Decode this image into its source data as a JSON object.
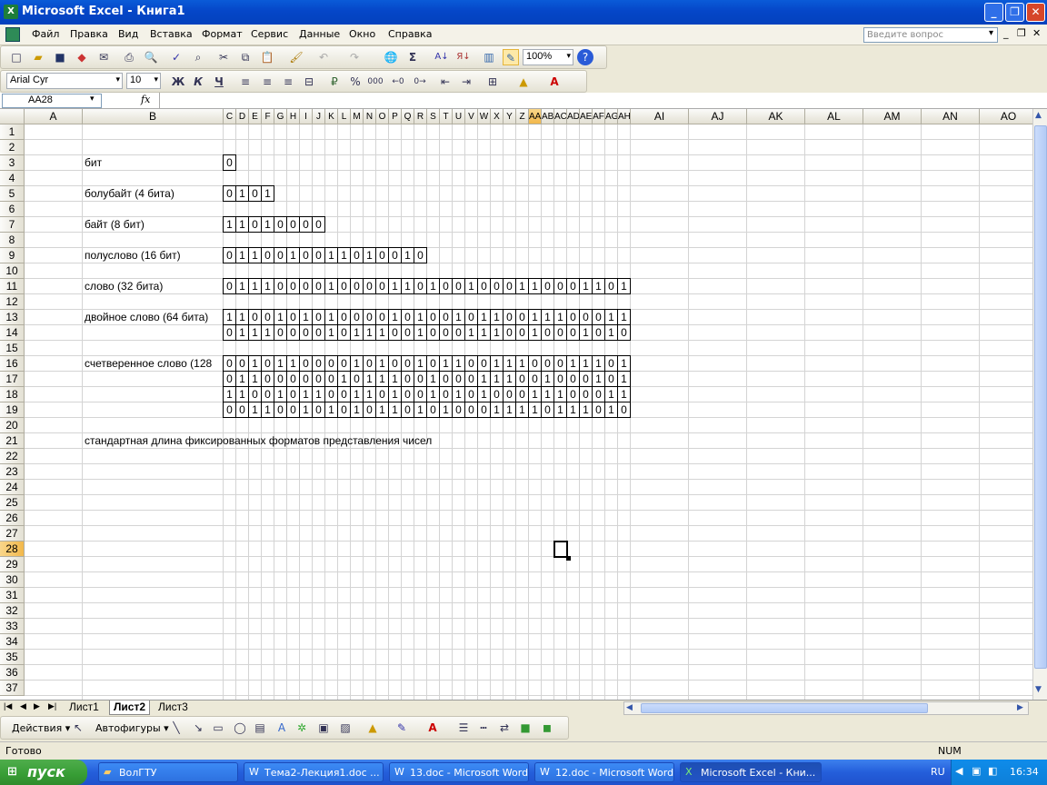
{
  "window": {
    "title": "Microsoft Excel - Книга1",
    "min": "_",
    "max": "❐",
    "close": "✕"
  },
  "menu": [
    "Файл",
    "Правка",
    "Вид",
    "Вставка",
    "Формат",
    "Сервис",
    "Данные",
    "Окно",
    "Справка"
  ],
  "ask_placeholder": "Введите вопрос",
  "toolbar": {
    "zoom": "100%",
    "font": "Arial Cyr",
    "size": "10",
    "bold": "Ж",
    "italic": "К",
    "underline": "Ч",
    "percent": "%",
    "thousands": "000"
  },
  "namebox": "AA28",
  "fx": "fx",
  "columns": [
    "A",
    "B",
    "C",
    "D",
    "E",
    "F",
    "G",
    "H",
    "I",
    "J",
    "K",
    "L",
    "M",
    "N",
    "O",
    "P",
    "Q",
    "R",
    "S",
    "T",
    "U",
    "V",
    "W",
    "X",
    "Y",
    "Z",
    "AA",
    "AB",
    "AC",
    "AD",
    "AE",
    "AF",
    "AG",
    "AH",
    "AI",
    "AJ",
    "AK",
    "AL",
    "AM",
    "AN",
    "AO"
  ],
  "row_count": 37,
  "labels": [
    {
      "row": 3,
      "text": "бит"
    },
    {
      "row": 5,
      "text": "болубайт (4 бита)"
    },
    {
      "row": 7,
      "text": "байт (8 бит)"
    },
    {
      "row": 9,
      "text": "полуслово (16 бит)"
    },
    {
      "row": 11,
      "text": "слово (32 бита)"
    },
    {
      "row": 13,
      "text": "двойное слово (64 бита)"
    },
    {
      "row": 16,
      "text": "счетверенное слово (128"
    },
    {
      "row": 21,
      "text": "стандартная длина фиксированных форматов представления чисел"
    }
  ],
  "bit_rows": [
    {
      "row": 3,
      "bits": "0"
    },
    {
      "row": 5,
      "bits": "0101"
    },
    {
      "row": 7,
      "bits": "11010000"
    },
    {
      "row": 9,
      "bits": "0110010011010010"
    },
    {
      "row": 11,
      "bits": "01110000100001101001000110001101"
    },
    {
      "row": 13,
      "bits": "11001010100001010010110011100011"
    },
    {
      "row": 14,
      "bits": "01110000101110010001110010001010"
    },
    {
      "row": 16,
      "bits": "00101100001010010110011100011101"
    },
    {
      "row": 17,
      "bits": "01100000010111001000111001000101"
    },
    {
      "row": 18,
      "bits": "11001011001101001010100011100011"
    },
    {
      "row": 19,
      "bits": "00110010101011010100011110111010"
    }
  ],
  "tabs": [
    "Лист1",
    "Лист2",
    "Лист3"
  ],
  "active_tab": "Лист2",
  "drawbar": {
    "actions": "Действия",
    "autoshapes": "Автофигуры"
  },
  "status": {
    "ready": "Готово",
    "num": "NUM"
  },
  "taskbar": {
    "start": "пуск",
    "tasks": [
      "ВолГТУ",
      "Тема2-Лекция1.doc ...",
      "13.doc - Microsoft Word",
      "12.doc - Microsoft Word",
      "Microsoft Excel - Кни..."
    ],
    "lang": "RU",
    "time": "16:34"
  }
}
